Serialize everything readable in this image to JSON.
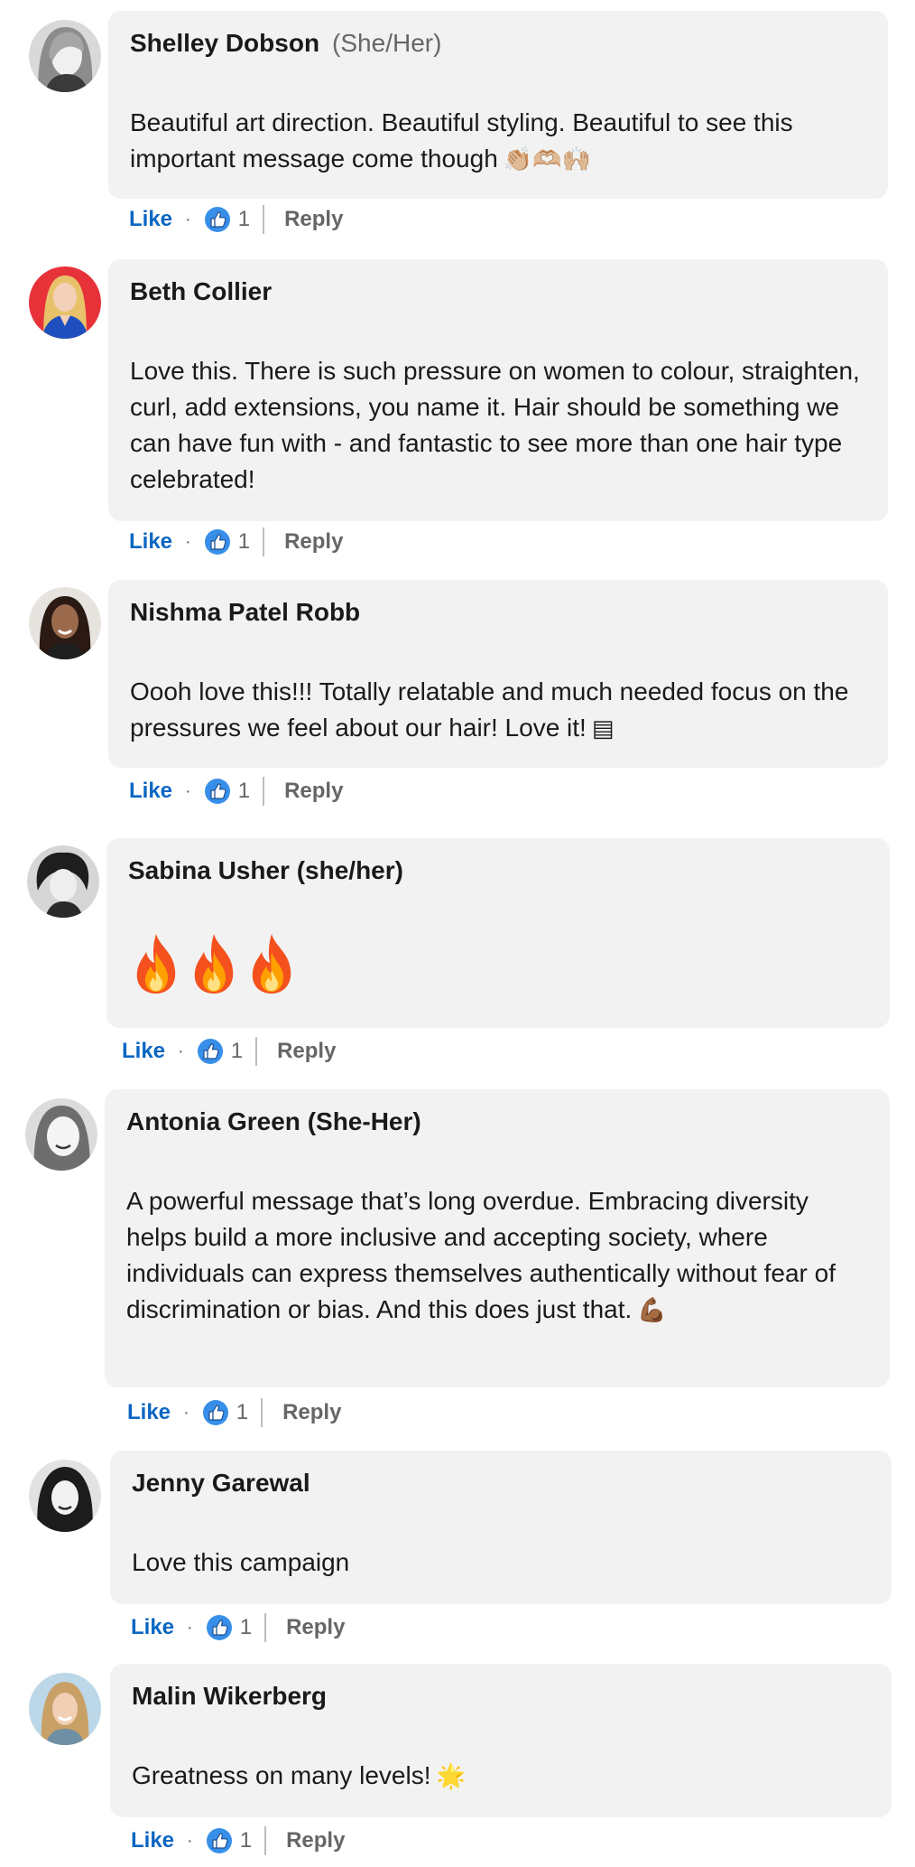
{
  "actions": {
    "like_label": "Like",
    "dot": "·",
    "reply_label": "Reply",
    "reaction_icon": "like-reaction-icon"
  },
  "comments": [
    {
      "author": "Shelley Dobson",
      "pronouns": "(She/Her)",
      "text": "Beautiful art direction. Beautiful styling. Beautiful to see this important message come though",
      "emoji": "👏🏼🫶🏼🙌🏼",
      "reaction_count": "1"
    },
    {
      "author": "Beth Collier",
      "pronouns": "",
      "text": "Love this. There is such pressure on women to colour, straighten, curl, add extensions, you name it. Hair should be something we can have fun with - and fantastic to see more than one hair type celebrated!",
      "emoji": "",
      "reaction_count": "1"
    },
    {
      "author": "Nishma Patel Robb",
      "pronouns": "",
      "text": "Oooh love this!!! Totally relatable and much needed focus on the pressures we feel about our hair! Love it!",
      "emoji": "▤",
      "reaction_count": "1"
    },
    {
      "author": "Sabina Usher (she/her)",
      "pronouns": "",
      "text": "",
      "emoji": "🔥🔥🔥",
      "reaction_count": "1"
    },
    {
      "author": "Antonia Green (She-Her)",
      "pronouns": "",
      "text": "A powerful message that’s long overdue. Embracing diversity helps build a more inclusive and accepting society, where individuals can express themselves authentically without fear of discrimination or bias. And this does just that.",
      "emoji": "💪🏾",
      "reaction_count": "1"
    },
    {
      "author": "Jenny Garewal",
      "pronouns": "",
      "text": "Love this campaign",
      "emoji": "",
      "reaction_count": "1"
    },
    {
      "author": "Malin Wikerberg",
      "pronouns": "",
      "text": "Greatness on many levels!",
      "emoji": "🌟",
      "reaction_count": "1"
    }
  ],
  "colors": {
    "like_blue": "#0a66c2",
    "bubble_bg": "#f2f2f2",
    "muted_text": "#666666",
    "reaction_blue": "#378fe9"
  }
}
